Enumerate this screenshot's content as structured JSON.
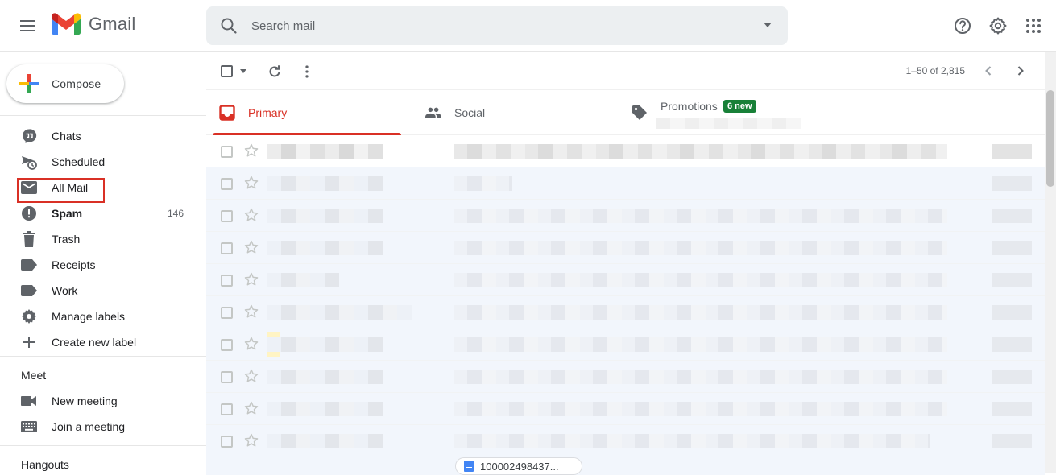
{
  "app": {
    "name": "Gmail"
  },
  "search": {
    "placeholder": "Search mail"
  },
  "header_icons": [
    "support-icon",
    "settings-icon",
    "apps-icon"
  ],
  "sidebar": {
    "compose_label": "Compose",
    "items": [
      {
        "label": "Chats",
        "icon": "chat-icon",
        "count": ""
      },
      {
        "label": "Scheduled",
        "icon": "scheduled-icon",
        "count": ""
      },
      {
        "label": "All Mail",
        "icon": "mail-icon",
        "count": ""
      },
      {
        "label": "Spam",
        "icon": "spam-icon",
        "count": "146"
      },
      {
        "label": "Trash",
        "icon": "trash-icon",
        "count": ""
      },
      {
        "label": "Receipts",
        "icon": "label-icon",
        "count": ""
      },
      {
        "label": "Work",
        "icon": "label-icon",
        "count": ""
      },
      {
        "label": "Manage labels",
        "icon": "gear-icon",
        "count": ""
      },
      {
        "label": "Create new label",
        "icon": "plus-icon",
        "count": ""
      }
    ],
    "meet": {
      "title": "Meet",
      "items": [
        {
          "label": "New meeting",
          "icon": "video-icon"
        },
        {
          "label": "Join a meeting",
          "icon": "keyboard-icon"
        }
      ]
    },
    "hangouts_title": "Hangouts"
  },
  "toolbar": {
    "pagination": "1–50 of 2,815"
  },
  "tabs": [
    {
      "label": "Primary",
      "icon": "inbox-icon",
      "active": true
    },
    {
      "label": "Social",
      "icon": "people-icon",
      "active": false
    },
    {
      "label": "Promotions",
      "icon": "tag-icon",
      "active": false,
      "badge": "6 new"
    }
  ],
  "email_rows": 10,
  "attachment": {
    "name": "100002498437..."
  },
  "colors": {
    "accent_red": "#d93025",
    "badge_green": "#188038",
    "search_bg": "#eceff1"
  }
}
